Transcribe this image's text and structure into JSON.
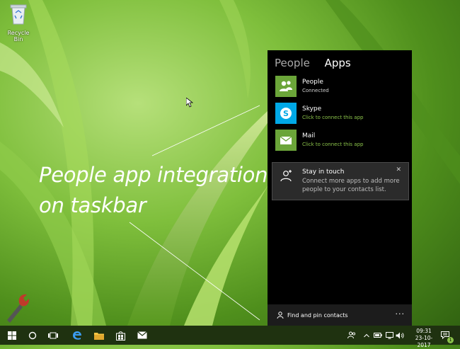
{
  "desktop": {
    "recycle_bin_label": "Recycle Bin",
    "caption_line1": "People app integration",
    "caption_line2": "on taskbar"
  },
  "people_panel": {
    "tabs": [
      {
        "label": "People",
        "active": false
      },
      {
        "label": "Apps",
        "active": true
      }
    ],
    "apps": [
      {
        "name": "People",
        "status": "Connected",
        "icon": "people-icon",
        "icon_bg": "#6ba539",
        "status_color": "#d0d0d0"
      },
      {
        "name": "Skype",
        "status": "Click to connect this app",
        "icon": "skype-icon",
        "icon_bg": "#00a8e6",
        "status_color": "#8bc34a"
      },
      {
        "name": "Mail",
        "status": "Click to connect this app",
        "icon": "mail-icon",
        "icon_bg": "#6ba539",
        "status_color": "#8bc34a"
      }
    ],
    "toast": {
      "title": "Stay in touch",
      "body": "Connect more apps to add more people to your contacts list.",
      "close": "✕"
    },
    "footer": {
      "label": "Find and pin contacts",
      "more": "···"
    }
  },
  "taskbar": {
    "time": "09:31",
    "date": "23-10-2017",
    "notification_count": "1",
    "icons": [
      "windows-start-icon",
      "cortana-circle-icon",
      "task-view-icon",
      "edge-icon",
      "file-explorer-icon",
      "store-icon",
      "mail-icon"
    ],
    "tray_icons": [
      "people-icon",
      "chevron-up-icon",
      "battery-icon",
      "network-icon",
      "volume-icon",
      "action-center-icon"
    ]
  },
  "colors": {
    "accent_green": "#6ba539",
    "link_green": "#8bc34a",
    "skype_blue": "#00a8e6",
    "panel_bg": "#000000"
  }
}
